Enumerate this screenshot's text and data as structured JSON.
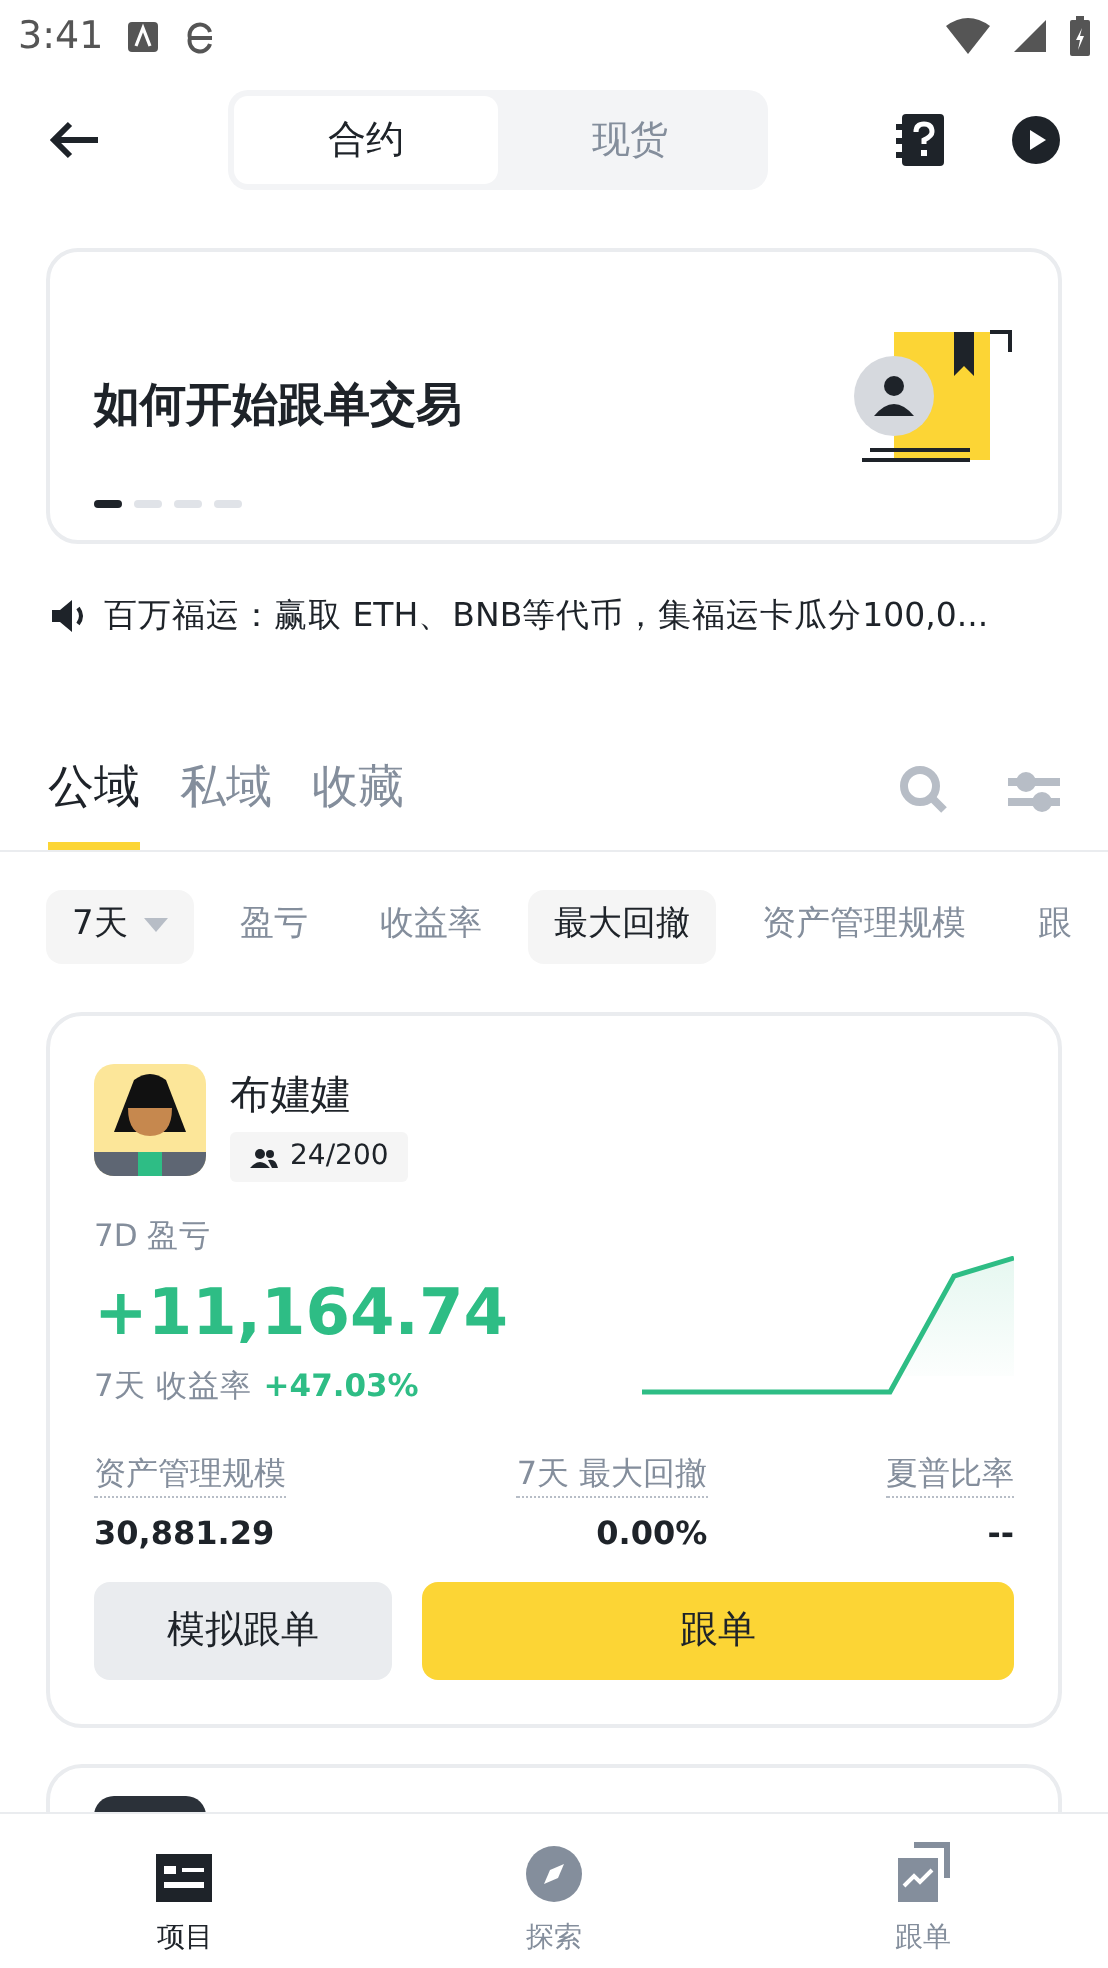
{
  "status_bar": {
    "time": "3:41"
  },
  "header": {
    "segments": [
      {
        "label": "合约",
        "selected": true
      },
      {
        "label": "现货",
        "selected": false
      }
    ]
  },
  "banner": {
    "title": "如何开始跟单交易",
    "pages": [
      {
        "selected": true
      },
      {
        "selected": false
      },
      {
        "selected": false
      },
      {
        "selected": false
      }
    ]
  },
  "notice": {
    "text": "百万福运：赢取 ETH、BNB等代币，集福运卡瓜分100,0..."
  },
  "tabs": [
    {
      "label": "公域",
      "selected": true
    },
    {
      "label": "私域",
      "selected": false
    },
    {
      "label": "收藏",
      "selected": false
    }
  ],
  "filters": [
    {
      "label": "7天",
      "kind": "dropdown",
      "selected": true
    },
    {
      "label": "盈亏",
      "kind": "chip",
      "selected": false
    },
    {
      "label": "收益率",
      "kind": "chip",
      "selected": false
    },
    {
      "label": "最大回撤",
      "kind": "chip",
      "selected": true
    },
    {
      "label": "资产管理规模",
      "kind": "chip",
      "selected": false
    },
    {
      "label": "跟",
      "kind": "chip",
      "selected": false
    }
  ],
  "trader": {
    "name": "布嫿嫿",
    "followers": "24/200",
    "pnl_label": "7D 盈亏",
    "pnl": "+11,164.74",
    "roi_label": "7天 收益率",
    "roi": "+47.03%",
    "stats": [
      {
        "label": "资产管理规模",
        "value": "30,881.29"
      },
      {
        "label": "7天 最大回撤",
        "value": "0.00%"
      },
      {
        "label": "夏普比率",
        "value": "--"
      }
    ],
    "buttons": [
      {
        "label": "模拟跟单",
        "kind": "secondary"
      },
      {
        "label": "跟单",
        "kind": "primary"
      }
    ]
  },
  "bottom_nav": [
    {
      "label": "项目",
      "kind": "list",
      "selected": true
    },
    {
      "label": "探索",
      "kind": "compass",
      "selected": false
    },
    {
      "label": "跟单",
      "kind": "chart",
      "selected": false
    }
  ]
}
